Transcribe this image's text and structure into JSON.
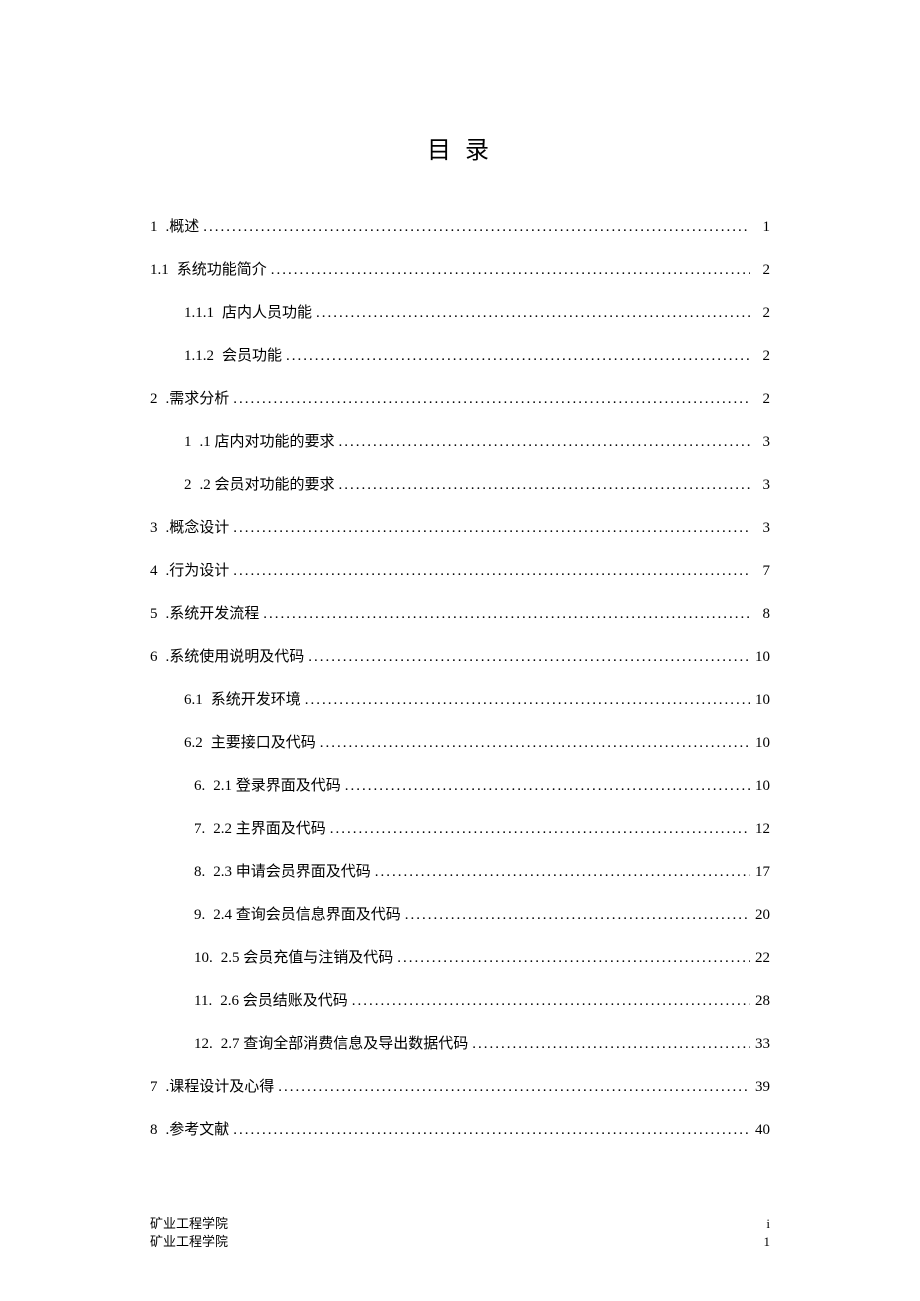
{
  "title": "目 录",
  "entries": [
    {
      "indent": 0,
      "num": "1",
      "label": ".概述",
      "page": "1"
    },
    {
      "indent": 0,
      "num": "1.1",
      "label": "系统功能简介",
      "page": "2"
    },
    {
      "indent": 1,
      "num": "1.1.1",
      "label": "店内人员功能",
      "page": "2"
    },
    {
      "indent": 1,
      "num": "1.1.2",
      "label": "会员功能",
      "page": "2"
    },
    {
      "indent": 0,
      "num": "2",
      "label": ".需求分析",
      "page": "2"
    },
    {
      "indent": 1,
      "num": "1",
      "label": ".1 店内对功能的要求",
      "page": "3"
    },
    {
      "indent": 1,
      "num": "2",
      "label": ".2 会员对功能的要求",
      "page": "3"
    },
    {
      "indent": 0,
      "num": "3",
      "label": ".概念设计",
      "page": "3"
    },
    {
      "indent": 0,
      "num": "4",
      "label": ".行为设计",
      "page": "7"
    },
    {
      "indent": 0,
      "num": "5",
      "label": ".系统开发流程",
      "page": "8"
    },
    {
      "indent": 0,
      "num": "6",
      "label": ".系统使用说明及代码",
      "page": "10"
    },
    {
      "indent": 1,
      "num": "6.1",
      "label": "系统开发环境",
      "page": "10"
    },
    {
      "indent": 1,
      "num": "6.2",
      "label": "主要接口及代码",
      "page": "10"
    },
    {
      "indent": 2,
      "num": "6.",
      "label": "2.1 登录界面及代码",
      "page": "10"
    },
    {
      "indent": 2,
      "num": "7.",
      "label": "2.2 主界面及代码",
      "page": "12"
    },
    {
      "indent": 2,
      "num": "8.",
      "label": "2.3 申请会员界面及代码",
      "page": "17"
    },
    {
      "indent": 2,
      "num": "9.",
      "label": "2.4 查询会员信息界面及代码",
      "page": "20"
    },
    {
      "indent": 2,
      "num": "10.",
      "label": "2.5 会员充值与注销及代码",
      "page": "22"
    },
    {
      "indent": 2,
      "num": "11.",
      "label": "2.6 会员结账及代码",
      "page": "28"
    },
    {
      "indent": 2,
      "num": "12.",
      "label": "2.7 查询全部消费信息及导出数据代码",
      "page": "33"
    },
    {
      "indent": 0,
      "num": "7",
      "label": ".课程设计及心得",
      "page": "39"
    },
    {
      "indent": 0,
      "num": "8",
      "label": ".参考文献",
      "page": "40"
    }
  ],
  "footer": {
    "line1_left": "矿业工程学院",
    "line1_right": "i",
    "line2_left": "矿业工程学院",
    "line2_right": "1"
  }
}
